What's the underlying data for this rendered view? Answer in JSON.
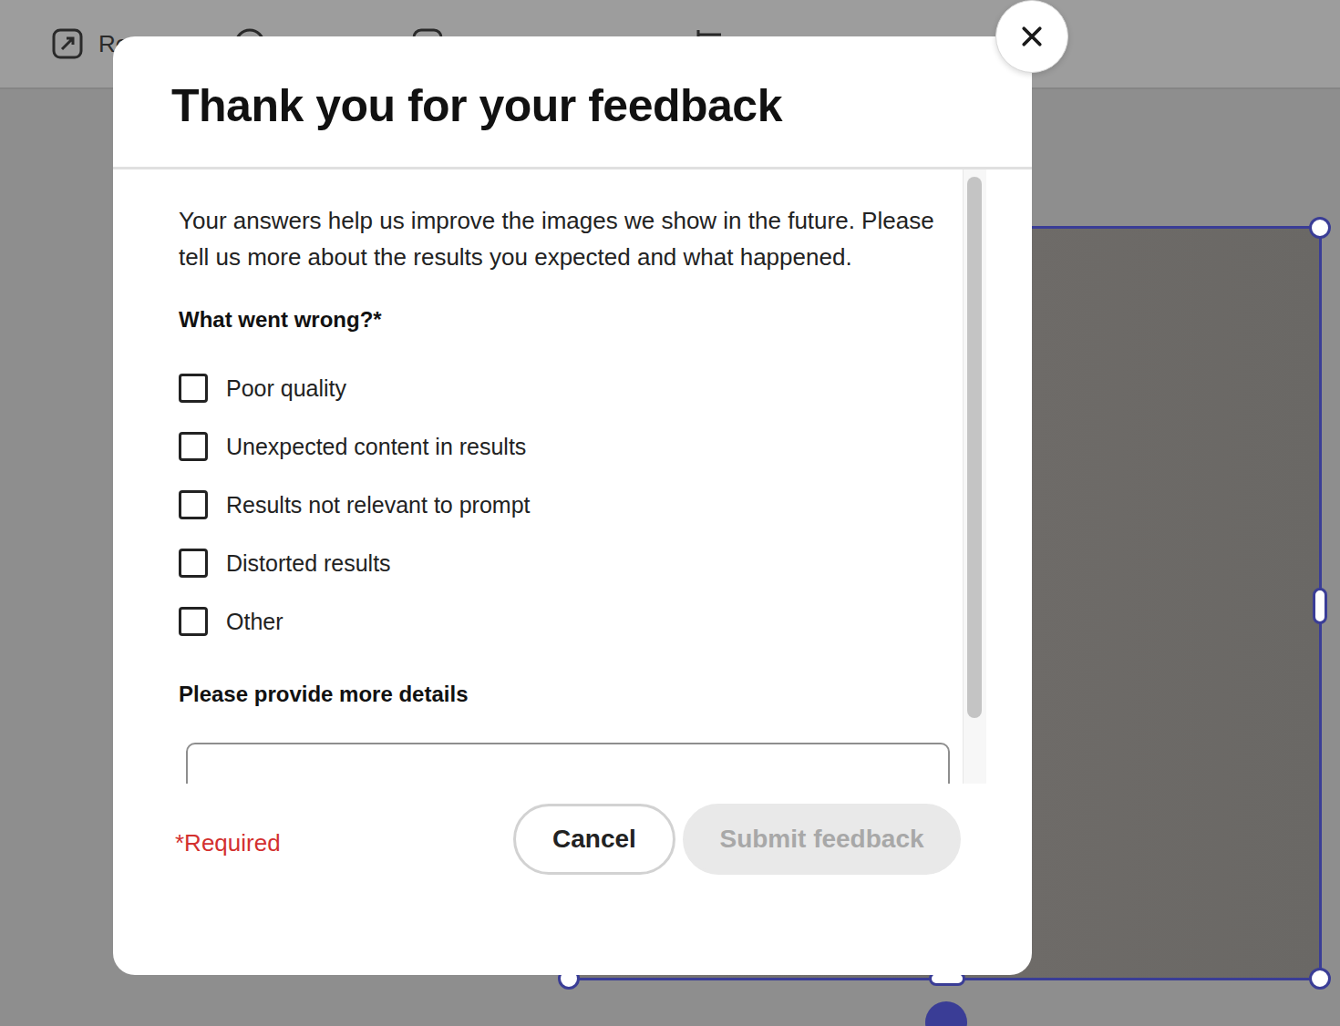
{
  "toolbar": {
    "items": [
      {
        "label": "Re"
      }
    ]
  },
  "dialog": {
    "title": "Thank you for your feedback",
    "intro": "Your answers help us improve the images we show in the future. Please tell us more about the results you expected and what happened.",
    "question": "What went wrong?*",
    "options": [
      {
        "label": "Poor quality",
        "checked": false
      },
      {
        "label": "Unexpected content in results",
        "checked": false
      },
      {
        "label": "Results not relevant to prompt",
        "checked": false
      },
      {
        "label": "Distorted results",
        "checked": false
      },
      {
        "label": "Other",
        "checked": false
      }
    ],
    "details_label": "Please provide more details",
    "required_note": "*Required",
    "buttons": [
      {
        "label": "Cancel",
        "kind": "secondary",
        "disabled": false
      },
      {
        "label": "Submit feedback",
        "kind": "primary",
        "disabled": true
      }
    ]
  }
}
